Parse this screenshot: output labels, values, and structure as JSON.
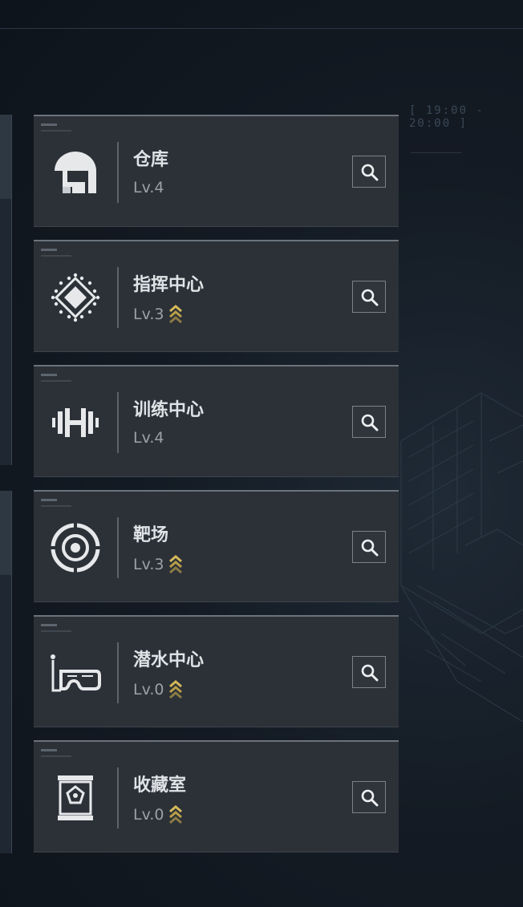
{
  "header": {
    "time_range": "[ 19:00 - 20:00 ]"
  },
  "facilities": [
    {
      "name": "仓库",
      "level": "Lv.4",
      "icon": "warehouse-icon",
      "upgradable": false
    },
    {
      "name": "指挥中心",
      "level": "Lv.3",
      "icon": "command-center-icon",
      "upgradable": true
    },
    {
      "name": "训练中心",
      "level": "Lv.4",
      "icon": "dumbbell-icon",
      "upgradable": false
    },
    {
      "name": "靶场",
      "level": "Lv.3",
      "icon": "target-icon",
      "upgradable": true
    },
    {
      "name": "潜水中心",
      "level": "Lv.0",
      "icon": "diving-mask-icon",
      "upgradable": true
    },
    {
      "name": "收藏室",
      "level": "Lv.0",
      "icon": "display-case-icon",
      "upgradable": true
    }
  ],
  "colors": {
    "background": "#141b24",
    "card": "#2c3138",
    "card_border": "#6b737c",
    "text_name": "#e0e3e6",
    "text_level": "#9aa1a8",
    "upgrade_gold": "#d4b85a"
  }
}
